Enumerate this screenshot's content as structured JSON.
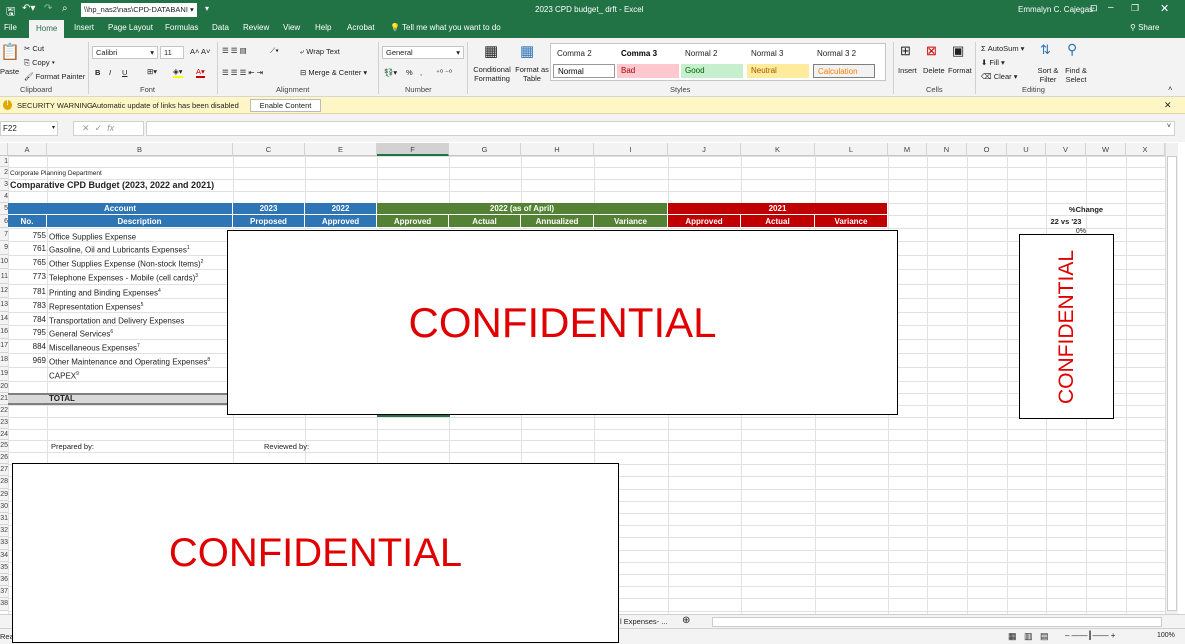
{
  "title_bar": {
    "path": "\\\\hp_nas2\\nas\\CPD-DATABANI",
    "doc_title": "2023 CPD budget_ drft  -  Excel",
    "user": "Emmalyn C. Cajegas",
    "share": "Share"
  },
  "tabs": [
    "File",
    "Home",
    "Insert",
    "Page Layout",
    "Formulas",
    "Data",
    "Review",
    "View",
    "Help",
    "Acrobat"
  ],
  "tell_me": "Tell me what you want to do",
  "ribbon": {
    "clipboard": {
      "paste": "Paste",
      "cut": "Cut",
      "copy": "Copy",
      "format_painter": "Format Painter",
      "label": "Clipboard"
    },
    "font": {
      "name": "Calibri",
      "size": "11",
      "label": "Font",
      "bold": "B",
      "italic": "I",
      "underline": "U"
    },
    "alignment": {
      "wrap": "Wrap Text",
      "merge": "Merge & Center",
      "label": "Alignment"
    },
    "number": {
      "format": "General",
      "percent": "%",
      "comma": ",",
      "label": "Number"
    },
    "styles": {
      "conditional": "Conditional Formatting",
      "format_table": "Format as Table",
      "label": "Styles",
      "cells": [
        {
          "name": "Comma 2",
          "bg": "#ffffff",
          "fg": "#222"
        },
        {
          "name": "Comma 3",
          "bg": "#ffffff",
          "fg": "#000"
        },
        {
          "name": "Normal 2",
          "bg": "#ffffff",
          "fg": "#222"
        },
        {
          "name": "Normal 3",
          "bg": "#ffffff",
          "fg": "#222"
        },
        {
          "name": "Normal 3 2",
          "bg": "#ffffff",
          "fg": "#222"
        },
        {
          "name": "Normal",
          "bg": "#ffffff",
          "fg": "#000"
        },
        {
          "name": "Bad",
          "bg": "#ffc7ce",
          "fg": "#9c0006"
        },
        {
          "name": "Good",
          "bg": "#c6efce",
          "fg": "#006100"
        },
        {
          "name": "Neutral",
          "bg": "#ffeb9c",
          "fg": "#9c5700"
        },
        {
          "name": "Calculation",
          "bg": "#f2f2f2",
          "fg": "#fa7d00"
        }
      ]
    },
    "cells": {
      "insert": "Insert",
      "delete": "Delete",
      "format": "Format",
      "label": "Cells"
    },
    "editing": {
      "autosum": "AutoSum",
      "fill": "Fill",
      "clear": "Clear",
      "sort": "Sort & Filter",
      "find": "Find & Select",
      "label": "Editing"
    }
  },
  "security": {
    "title": "SECURITY WARNING",
    "message": "Automatic update of links has been disabled",
    "button": "Enable Content"
  },
  "formula_bar": {
    "name_box": "F22",
    "value": ""
  },
  "columns": [
    "A",
    "B",
    "C",
    "E",
    "F",
    "G",
    "H",
    "I",
    "J",
    "K",
    "L",
    "M",
    "N",
    "O",
    "U",
    "V",
    "W",
    "X"
  ],
  "rows": [
    "1",
    "2",
    "3",
    "4",
    "5",
    "6",
    "7",
    "9",
    "10",
    "11",
    "12",
    "13",
    "14",
    "16",
    "17",
    "18",
    "19",
    "20",
    "21",
    "22",
    "23",
    "24",
    "25",
    "26",
    "27",
    "28",
    "29",
    "30",
    "31",
    "32",
    "33",
    "34",
    "35",
    "36",
    "37",
    "38"
  ],
  "sheet": {
    "department": "Corporate Planning Department",
    "title": "Comparative CPD Budget (2023, 2022 and 2021)",
    "headers": {
      "account": "Account",
      "no": "No.",
      "description": "Description",
      "y2023": "2023",
      "proposed": "Proposed",
      "y2022": "2022",
      "approved": "Approved",
      "y2022_april": "2022 (as of April)",
      "approved2": "Approved",
      "actual": "Actual",
      "annualized": "Annualized",
      "variance": "Variance",
      "y2021": "2021",
      "approved3": "Approved",
      "actual2": "Actual",
      "variance2": "Variance",
      "pct_change": "%Change",
      "vs": "22 vs '23",
      "pct": "0%"
    },
    "accounts": [
      {
        "no": "755",
        "desc": "Office Supplies Expense",
        "sup": ""
      },
      {
        "no": "761",
        "desc": "Gasoline, Oil and Lubricants Expenses",
        "sup": "1"
      },
      {
        "no": "765",
        "desc": "Other Supplies Expense (Non-stock Items)",
        "sup": "2"
      },
      {
        "no": "773",
        "desc": "Telephone Expenses - Mobile (cell cards)",
        "sup": "3"
      },
      {
        "no": "781",
        "desc": "Printing and Binding Expenses",
        "sup": "4"
      },
      {
        "no": "783",
        "desc": "Representation Expenses",
        "sup": "5"
      },
      {
        "no": "784",
        "desc": "Transportation and Delivery Expenses",
        "sup": ""
      },
      {
        "no": "795",
        "desc": "General Services",
        "sup": "6"
      },
      {
        "no": "884",
        "desc": "Miscellaneous Expenses",
        "sup": "7"
      },
      {
        "no": "969",
        "desc": "Other Maintenance and Operating Expenses",
        "sup": "8"
      },
      {
        "no": "",
        "desc": "CAPEX",
        "sup": "9"
      }
    ],
    "total": "TOTAL",
    "prepared_by": "Prepared by:",
    "reviewed_by": "Reviewed by:"
  },
  "redaction": {
    "text": "CONFIDENTIAL",
    "color": "#e00000"
  },
  "sheet_tabs": {
    "visible": "l Expenses- ..."
  },
  "status": {
    "left": "Read",
    "zoom": "100%"
  },
  "colors": {
    "excel_green": "#217346",
    "blue_header": "#2e75b6",
    "green_header": "#548235",
    "red_header": "#c00000"
  }
}
